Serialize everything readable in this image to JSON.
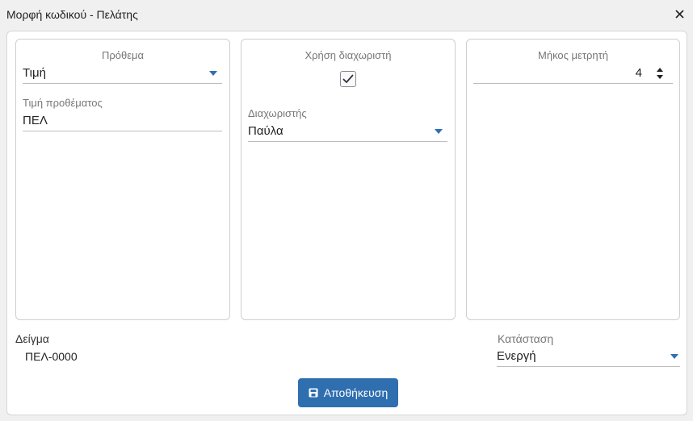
{
  "window": {
    "title": "Μορφή κωδικού - Πελάτης"
  },
  "prefix_panel": {
    "prefix_label": "Πρόθεμα",
    "prefix_value": "Τιμή",
    "prefix_value_label": "Τιμή προθέματος",
    "prefix_value_input": "ΠΕΛ"
  },
  "separator_panel": {
    "use_separator_label": "Χρήση διαχωριστή",
    "use_separator_checked": true,
    "separator_label": "Διαχωριστής",
    "separator_value": "Παύλα"
  },
  "counter_panel": {
    "counter_length_label": "Μήκος μετρητή",
    "counter_length_value": "4"
  },
  "sample": {
    "label": "Δείγμα",
    "value": "ΠΕΛ-0000"
  },
  "status": {
    "label": "Κατάσταση",
    "value": "Ενεργή"
  },
  "actions": {
    "save_label": "Αποθήκευση"
  },
  "colors": {
    "accent": "#2f6fb0",
    "background": "#f0f0f0"
  },
  "icons": {
    "close": "close-icon",
    "save": "save-icon",
    "check": "check-icon",
    "dropdown": "chevron-down-icon",
    "spinner": "spinner-icon"
  }
}
